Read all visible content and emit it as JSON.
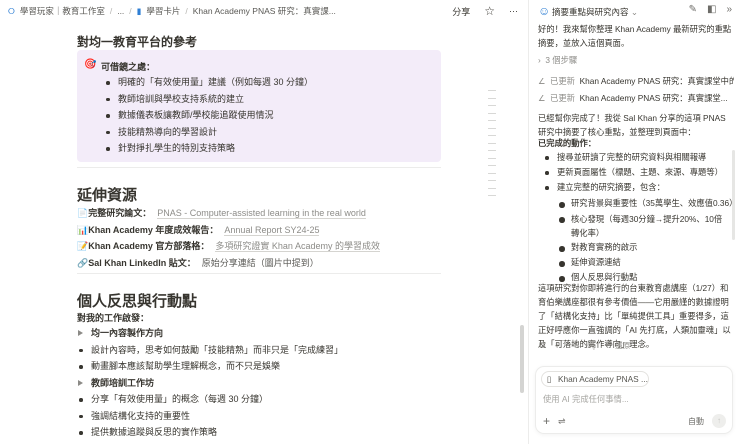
{
  "breadcrumb": {
    "workspace": "學習玩家｜教育工作室",
    "ellipsis": "...",
    "parent": "學習卡片",
    "page": "Khan Academy PNAS 研究：真實課..."
  },
  "topbar": {
    "share": "分享"
  },
  "section_ref": {
    "title": "對均一教育平台的參考",
    "callout_title": "可借鏡之處：",
    "items": [
      "明確的「有效使用量」建議（例如每週 30 分鐘）",
      "教師培訓與學校支持系統的建立",
      "數據儀表板讓教師/學校能追蹤使用情況",
      "技能精熟導向的學習設計",
      "針對掙扎學生的特別支持策略"
    ]
  },
  "resources": {
    "title": "延伸資源",
    "items": [
      {
        "icon": "📄",
        "label": "完整研究論文：",
        "value": "PNAS - Computer-assisted learning in the real world",
        "link": true
      },
      {
        "icon": "📊",
        "label": "Khan Academy 年度成效報告：",
        "value": "Annual Report SY24-25",
        "link": true
      },
      {
        "icon": "📝",
        "label": "Khan Academy 官方部落格：",
        "value": "多項研究證實 Khan Academy 的學習成效",
        "link": true
      },
      {
        "icon": "🔗",
        "label": "Sal Khan LinkedIn 貼文：",
        "value": "原始分享連結（圖片中提到）",
        "link": false
      }
    ]
  },
  "reflection": {
    "title": "個人反思與行動點",
    "subtitle": "對我的工作啟發：",
    "items": [
      {
        "text": "均一內容製作方向",
        "toggle": true
      },
      {
        "text": "設計內容時，思考如何鼓勵「技能精熟」而非只是「完成練習」"
      },
      {
        "text": "動畫腳本應該幫助學生理解概念，而不只是娛樂"
      },
      {
        "text": "教師培訓工作坊",
        "toggle": true
      },
      {
        "text": "分享「有效使用量」的概念（每週 30 分鐘）"
      },
      {
        "text": "強調結構化支持的重要性"
      },
      {
        "text": "提供數據追蹤與反思的實作策略"
      }
    ]
  },
  "sidebar": {
    "title": "摘要重點與研究內容",
    "intro": "好的！我來幫你整理 Khan Academy 最新研究的重點摘要，並放入這個頁面。",
    "steps": "3 個步驟",
    "updates": [
      {
        "label": "已更新",
        "page": "Khan Academy PNAS 研究：真實課堂中的..."
      },
      {
        "label": "已更新",
        "page": "Khan Academy PNAS 研究：真實課堂..."
      }
    ],
    "done_text": "已經幫你完成了！我從 Sal Khan 分享的這項 PNAS 研究中摘要了核心重點，並整理到頁面中：",
    "done_title": "已完成的動作：",
    "actions": [
      "搜尋並研讀了完整的研究資料與相關報導",
      "更新頁面屬性（標題、主題、來源、專題等）",
      "建立完整的研究摘要，包含："
    ],
    "sub_actions": [
      "研究背景與重要性（35萬學生、效應值0.36）",
      "核心發現（每週30分鐘→提升20%、10倍轉化率）",
      "對教育實務的啟示",
      "延伸資源連結",
      "個人反思與行動點"
    ],
    "closing": "這項研究對你即將進行的台東教育處講座（1/27）和育伯樂講座都很有參考價值——它用嚴謹的數據證明了「結構化支持」比「單純提供工具」重要得多，這正好呼應你一直強調的「AI 先打底，人類加靈魂」以及「可落地的實作導向」理念。",
    "retry": "還原",
    "chip": "Khan Academy PNAS ...",
    "placeholder": "使用 AI 完成任何事情...",
    "mode": "自動"
  }
}
